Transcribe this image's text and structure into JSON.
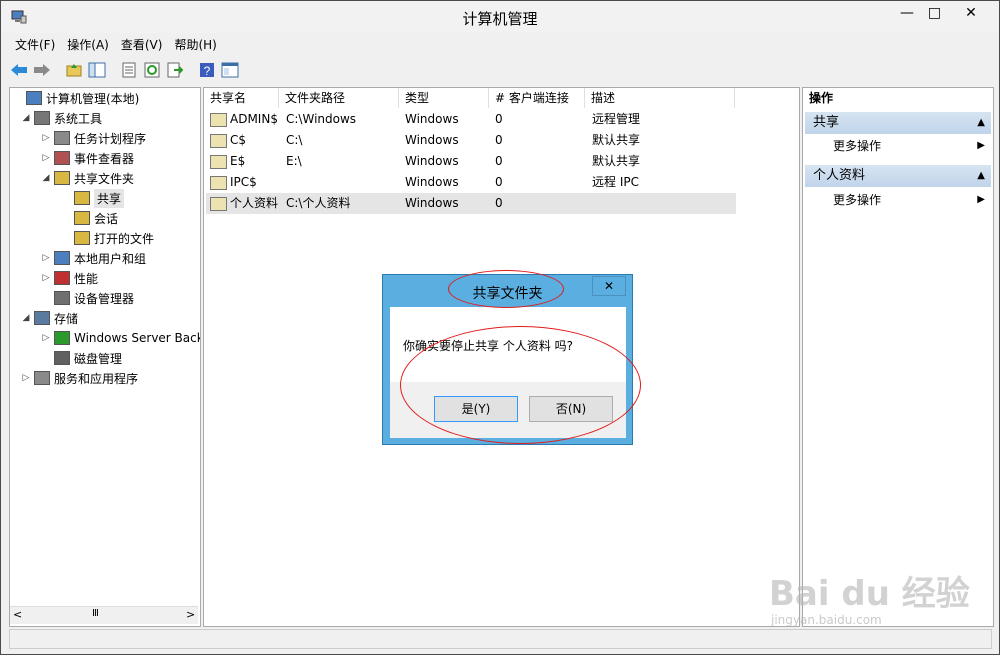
{
  "window": {
    "title": "计算机管理",
    "minimize_glyph": "—",
    "maximize_glyph": "□",
    "close_glyph": "✕"
  },
  "menu": [
    "文件(F)",
    "操作(A)",
    "查看(V)",
    "帮助(H)"
  ],
  "toolbar_icons": [
    "back-arrow-icon",
    "forward-arrow-icon",
    "up-folder-icon",
    "show-hide-tree-icon",
    "properties-icon",
    "refresh-icon",
    "export-list-icon",
    "help-icon",
    "console-icon"
  ],
  "tree": [
    {
      "label": "计算机管理(本地)",
      "level": 0,
      "expander": "",
      "icon": "computer-management-icon"
    },
    {
      "label": "系统工具",
      "level": 1,
      "expander": "◢",
      "icon": "system-tools-icon"
    },
    {
      "label": "任务计划程序",
      "level": 2,
      "expander": "▷",
      "icon": "task-scheduler-icon"
    },
    {
      "label": "事件查看器",
      "level": 2,
      "expander": "▷",
      "icon": "event-viewer-icon"
    },
    {
      "label": "共享文件夹",
      "level": 2,
      "expander": "◢",
      "icon": "shared-folders-icon"
    },
    {
      "label": "共享",
      "level": 3,
      "expander": "",
      "icon": "shares-icon",
      "selected": true
    },
    {
      "label": "会话",
      "level": 3,
      "expander": "",
      "icon": "sessions-icon"
    },
    {
      "label": "打开的文件",
      "level": 3,
      "expander": "",
      "icon": "open-files-icon"
    },
    {
      "label": "本地用户和组",
      "level": 2,
      "expander": "▷",
      "icon": "local-users-icon"
    },
    {
      "label": "性能",
      "level": 2,
      "expander": "▷",
      "icon": "performance-icon"
    },
    {
      "label": "设备管理器",
      "level": 2,
      "expander": "",
      "icon": "device-manager-icon"
    },
    {
      "label": "存储",
      "level": 1,
      "expander": "◢",
      "icon": "storage-icon"
    },
    {
      "label": "Windows Server Back",
      "level": 2,
      "expander": "▷",
      "icon": "windows-server-backup-icon"
    },
    {
      "label": "磁盘管理",
      "level": 2,
      "expander": "",
      "icon": "disk-management-icon"
    },
    {
      "label": "服务和应用程序",
      "level": 1,
      "expander": "▷",
      "icon": "services-apps-icon"
    }
  ],
  "tree_scroll": {
    "left": "<",
    "right": ">",
    "thumb": "Ⅲ"
  },
  "list": {
    "columns": [
      "共享名",
      "文件夹路径",
      "类型",
      "# 客户端连接",
      "描述"
    ],
    "rows": [
      {
        "name": "ADMIN$",
        "path": "C:\\Windows",
        "type": "Windows",
        "clients": "0",
        "desc": "远程管理"
      },
      {
        "name": "C$",
        "path": "C:\\",
        "type": "Windows",
        "clients": "0",
        "desc": "默认共享"
      },
      {
        "name": "E$",
        "path": "E:\\",
        "type": "Windows",
        "clients": "0",
        "desc": "默认共享"
      },
      {
        "name": "IPC$",
        "path": "",
        "type": "Windows",
        "clients": "0",
        "desc": "远程 IPC"
      },
      {
        "name": "个人资料",
        "path": "C:\\个人资料",
        "type": "Windows",
        "clients": "0",
        "desc": "",
        "selected": true
      }
    ]
  },
  "actions": {
    "header": "操作",
    "sections": [
      {
        "title": "共享",
        "item": "更多操作"
      },
      {
        "title": "个人资料",
        "item": "更多操作"
      }
    ]
  },
  "dialog": {
    "title": "共享文件夹",
    "close_glyph": "✕",
    "message": "你确实要停止共享 个人资料 吗?",
    "yes_label": "是(Y)",
    "no_label": "否(N)"
  },
  "watermark": {
    "brand": "Bai du 经验",
    "url": "jingyan.baidu.com"
  },
  "colors": {
    "dialog_frame": "#5aaee0",
    "annotation_red": "#e21b1b",
    "section_header": "#c8daee",
    "selection": "#e5e5e5"
  }
}
